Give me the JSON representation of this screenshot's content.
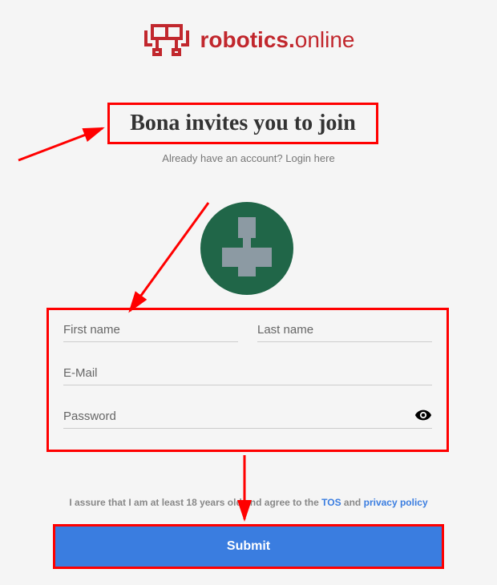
{
  "logo": {
    "text_bold": "robotics.",
    "text_light": "online"
  },
  "heading": "Bona invites you to join",
  "login_prompt": "Already have an account? Login here",
  "form": {
    "first_name": {
      "placeholder": "First name",
      "value": ""
    },
    "last_name": {
      "placeholder": "Last name",
      "value": ""
    },
    "email": {
      "placeholder": "E-Mail",
      "value": ""
    },
    "password": {
      "placeholder": "Password",
      "value": ""
    }
  },
  "disclaimer": {
    "prefix": "I assure that I am at least 18 years old and agree to the ",
    "tos": "TOS",
    "mid": " and ",
    "privacy": "privacy policy"
  },
  "submit_label": "Submit",
  "icons": {
    "eye": "eye-icon",
    "avatar": "avatar-icon",
    "logo": "logo-icon"
  },
  "colors": {
    "brand": "#c1272d",
    "highlight_border": "#ff0000",
    "primary_button": "#3a7de0",
    "avatar_bg": "#206648"
  }
}
